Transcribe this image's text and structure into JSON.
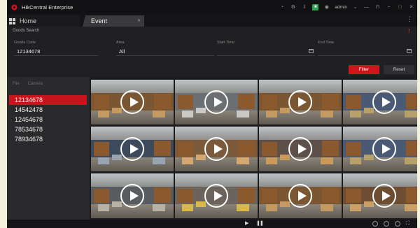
{
  "app": {
    "title": "HikCentral Enterprise",
    "username": "admin",
    "brand_color": "#d0141b"
  },
  "tabs": [
    {
      "label": "Home",
      "icon": "grid-icon"
    },
    {
      "label": "Event",
      "icon": "close-icon"
    }
  ],
  "search": {
    "section_title": "Goods Search",
    "fields": [
      {
        "label": "Goods Code",
        "value": "12134678"
      },
      {
        "label": "Area",
        "value": "All"
      },
      {
        "label": "Start Time",
        "value": ""
      },
      {
        "label": "End Time",
        "value": ""
      }
    ],
    "filter_label": "Filter",
    "reset_label": "Reset"
  },
  "left_panel": {
    "tabs": [
      "File",
      "Camera"
    ],
    "items": [
      "12134678",
      "14542478",
      "12454678",
      "78534678",
      "78934678"
    ],
    "selected_index": 0
  },
  "videos": [
    {
      "scene": "warehouse-shelves"
    },
    {
      "scene": "conveyor-belt"
    },
    {
      "scene": "warehouse-shelves"
    },
    {
      "scene": "sorting-hall"
    },
    {
      "scene": "conveyor-overhead"
    },
    {
      "scene": "warehouse-boxes"
    },
    {
      "scene": "box-handling"
    },
    {
      "scene": "sorting-hall"
    },
    {
      "scene": "conveyor-curve"
    },
    {
      "scene": "forklift"
    },
    {
      "scene": "warehouse-shelves"
    },
    {
      "scene": "warehouse-aisle"
    }
  ],
  "playback": {
    "play_icon": "play-icon",
    "pause_icon": "pause-icon"
  }
}
